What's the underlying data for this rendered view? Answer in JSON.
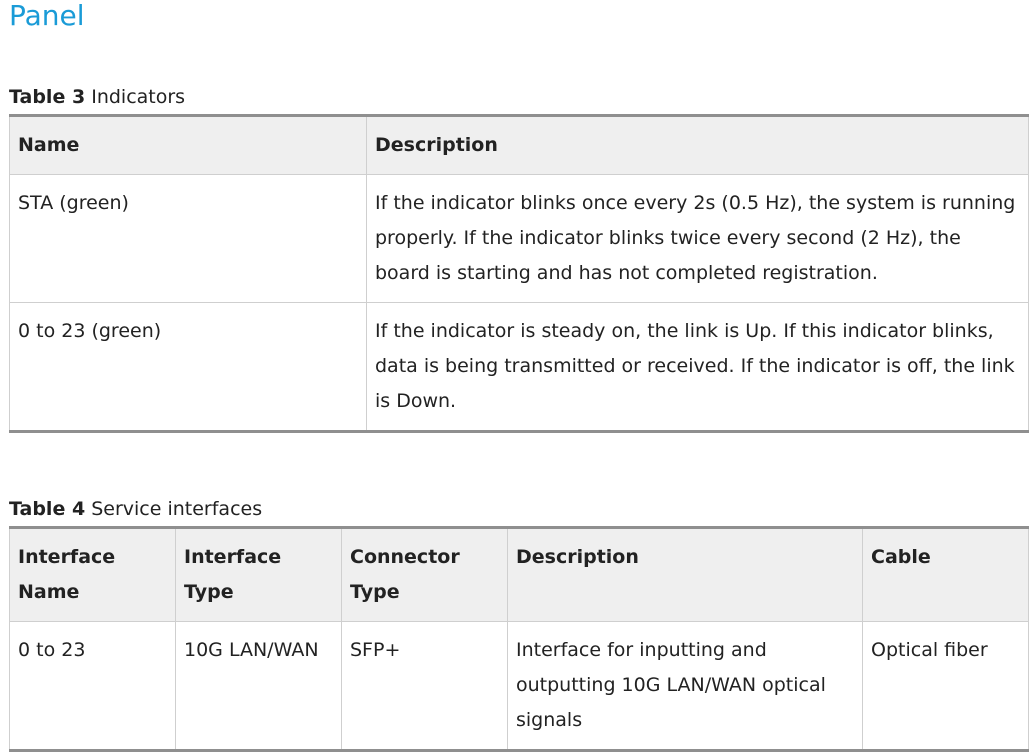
{
  "page": {
    "title": "Panel"
  },
  "table3": {
    "caption_num": "Table 3",
    "caption_text": " Indicators",
    "headers": [
      "Name",
      "Description"
    ],
    "rows": [
      {
        "name": "STA (green)",
        "description": "If the indicator blinks once every 2s (0.5 Hz), the system is running properly. If the indicator blinks twice every second (2 Hz), the board is starting and has not completed registration."
      },
      {
        "name": "0 to 23 (green)",
        "description": "If the indicator is steady on, the link is Up. If this indicator blinks, data is being transmitted or received. If the indicator is off, the link is Down."
      }
    ]
  },
  "table4": {
    "caption_num": "Table 4",
    "caption_text": " Service interfaces",
    "headers": [
      "Interface Name",
      "Interface Type",
      "Connector Type",
      "Description",
      "Cable"
    ],
    "rows": [
      {
        "interface_name": "0 to 23",
        "interface_type": "10G LAN/WAN",
        "connector_type": "SFP+",
        "description": "Interface for inputting and outputting 10G LAN/WAN optical signals",
        "cable": "Optical fiber"
      }
    ]
  }
}
